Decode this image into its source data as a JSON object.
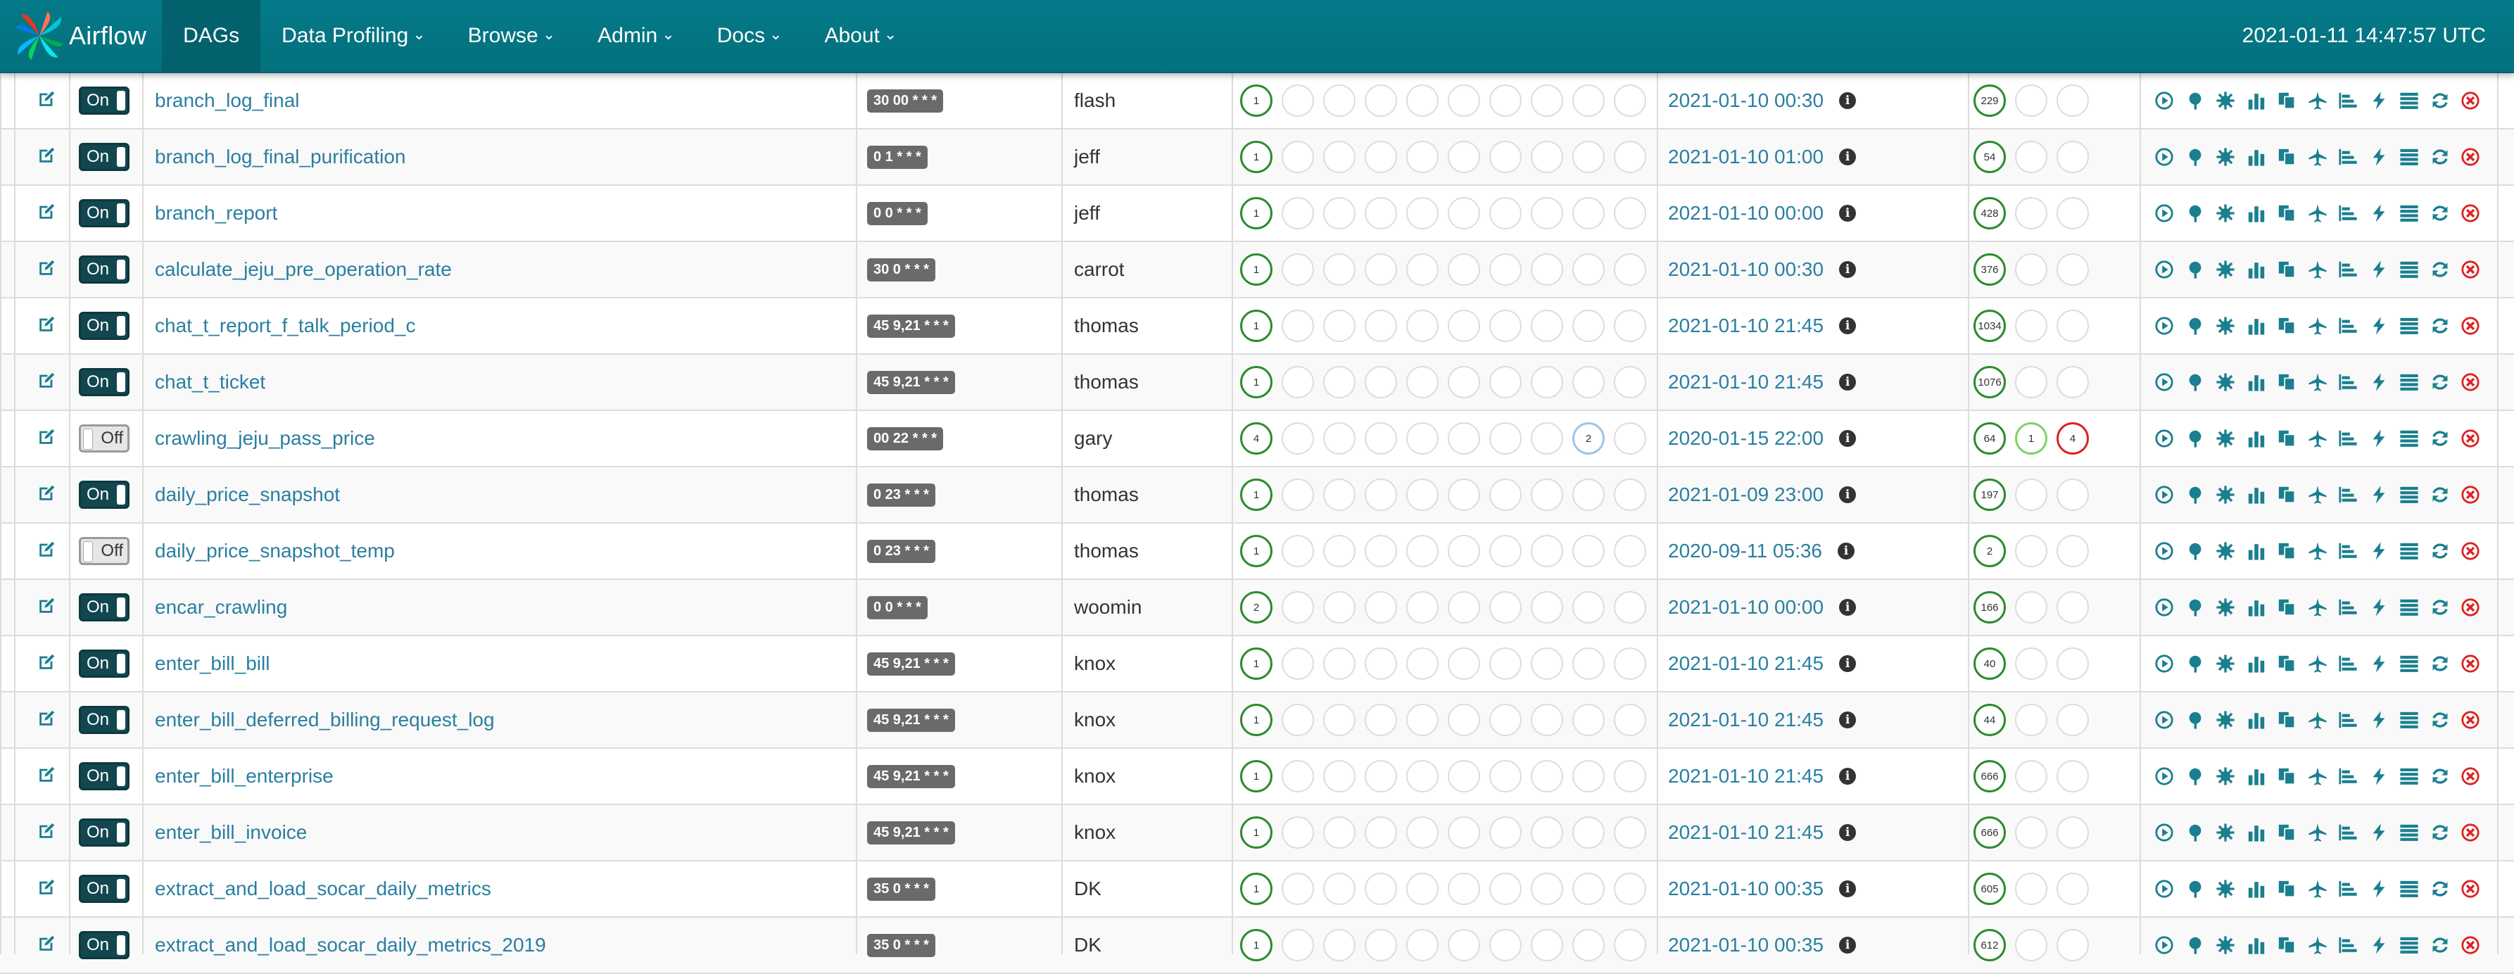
{
  "navbar": {
    "brand": "Airflow",
    "items": [
      {
        "label": "DAGs",
        "active": true,
        "dropdown": false
      },
      {
        "label": "Data Profiling",
        "active": false,
        "dropdown": true
      },
      {
        "label": "Browse",
        "active": false,
        "dropdown": true
      },
      {
        "label": "Admin",
        "active": false,
        "dropdown": true
      },
      {
        "label": "Docs",
        "active": false,
        "dropdown": true
      },
      {
        "label": "About",
        "active": false,
        "dropdown": true
      }
    ],
    "time": "2021-01-11 14:47:57 UTC"
  },
  "colors": {
    "navbar": "#017b88",
    "link": "#2a7fa0",
    "success": "#2c8c2c",
    "running": "#7fd16a",
    "failed": "#dd2222",
    "queued": "#9ec5e6",
    "toggle_on": "#12474f",
    "action_icon": "#1a7f8e"
  },
  "actions": [
    "trigger-dag-icon",
    "tree-view-icon",
    "graph-view-icon",
    "duration-chart-icon",
    "task-tries-icon",
    "landing-times-icon",
    "gantt-icon",
    "code-view-icon",
    "logs-icon",
    "refresh-icon",
    "delete-icon"
  ],
  "dags": [
    {
      "name": "branch_log_final",
      "on": true,
      "schedule": "30 00 * * *",
      "owner": "flash",
      "tasks": [
        {
          "n": "1",
          "s": "green"
        }
      ],
      "last_run": "2021-01-10 00:30",
      "runs": [
        {
          "n": "229",
          "s": "green"
        },
        {
          "n": "",
          "s": ""
        },
        {
          "n": "",
          "s": ""
        }
      ]
    },
    {
      "name": "branch_log_final_purification",
      "on": true,
      "schedule": "0 1 * * *",
      "owner": "jeff",
      "tasks": [
        {
          "n": "1",
          "s": "green"
        }
      ],
      "last_run": "2021-01-10 01:00",
      "runs": [
        {
          "n": "54",
          "s": "green"
        },
        {
          "n": "",
          "s": ""
        },
        {
          "n": "",
          "s": ""
        }
      ]
    },
    {
      "name": "branch_report",
      "on": true,
      "schedule": "0 0 * * *",
      "owner": "jeff",
      "tasks": [
        {
          "n": "1",
          "s": "green"
        }
      ],
      "last_run": "2021-01-10 00:00",
      "runs": [
        {
          "n": "428",
          "s": "green"
        },
        {
          "n": "",
          "s": ""
        },
        {
          "n": "",
          "s": ""
        }
      ]
    },
    {
      "name": "calculate_jeju_pre_operation_rate",
      "on": true,
      "schedule": "30 0 * * *",
      "owner": "carrot",
      "tasks": [
        {
          "n": "1",
          "s": "green"
        }
      ],
      "last_run": "2021-01-10 00:30",
      "runs": [
        {
          "n": "376",
          "s": "green"
        },
        {
          "n": "",
          "s": ""
        },
        {
          "n": "",
          "s": ""
        }
      ]
    },
    {
      "name": "chat_t_report_f_talk_period_c",
      "on": true,
      "schedule": "45 9,21 * * *",
      "owner": "thomas",
      "tasks": [
        {
          "n": "1",
          "s": "green"
        }
      ],
      "last_run": "2021-01-10 21:45",
      "runs": [
        {
          "n": "1034",
          "s": "green"
        },
        {
          "n": "",
          "s": ""
        },
        {
          "n": "",
          "s": ""
        }
      ]
    },
    {
      "name": "chat_t_ticket",
      "on": true,
      "schedule": "45 9,21 * * *",
      "owner": "thomas",
      "tasks": [
        {
          "n": "1",
          "s": "green"
        }
      ],
      "last_run": "2021-01-10 21:45",
      "runs": [
        {
          "n": "1076",
          "s": "green"
        },
        {
          "n": "",
          "s": ""
        },
        {
          "n": "",
          "s": ""
        }
      ]
    },
    {
      "name": "crawling_jeju_pass_price",
      "on": false,
      "schedule": "00 22 * * *",
      "owner": "gary",
      "tasks": [
        {
          "n": "4",
          "s": "green"
        },
        {
          "n": "",
          "s": ""
        },
        {
          "n": "",
          "s": ""
        },
        {
          "n": "",
          "s": ""
        },
        {
          "n": "",
          "s": ""
        },
        {
          "n": "",
          "s": ""
        },
        {
          "n": "",
          "s": ""
        },
        {
          "n": "",
          "s": ""
        },
        {
          "n": "2",
          "s": "blue"
        },
        {
          "n": "",
          "s": ""
        }
      ],
      "last_run": "2020-01-15 22:00",
      "runs": [
        {
          "n": "64",
          "s": "green"
        },
        {
          "n": "1",
          "s": "lgreen"
        },
        {
          "n": "4",
          "s": "red"
        }
      ]
    },
    {
      "name": "daily_price_snapshot",
      "on": true,
      "schedule": "0 23 * * *",
      "owner": "thomas",
      "tasks": [
        {
          "n": "1",
          "s": "green"
        }
      ],
      "last_run": "2021-01-09 23:00",
      "runs": [
        {
          "n": "197",
          "s": "green"
        },
        {
          "n": "",
          "s": ""
        },
        {
          "n": "",
          "s": ""
        }
      ]
    },
    {
      "name": "daily_price_snapshot_temp",
      "on": false,
      "schedule": "0 23 * * *",
      "owner": "thomas",
      "tasks": [
        {
          "n": "1",
          "s": "green"
        }
      ],
      "last_run": "2020-09-11 05:36",
      "runs": [
        {
          "n": "2",
          "s": "green"
        },
        {
          "n": "",
          "s": ""
        },
        {
          "n": "",
          "s": ""
        }
      ]
    },
    {
      "name": "encar_crawling",
      "on": true,
      "schedule": "0 0 * * *",
      "owner": "woomin",
      "tasks": [
        {
          "n": "2",
          "s": "green"
        }
      ],
      "last_run": "2021-01-10 00:00",
      "runs": [
        {
          "n": "166",
          "s": "green"
        },
        {
          "n": "",
          "s": ""
        },
        {
          "n": "",
          "s": ""
        }
      ]
    },
    {
      "name": "enter_bill_bill",
      "on": true,
      "schedule": "45 9,21 * * *",
      "owner": "knox",
      "tasks": [
        {
          "n": "1",
          "s": "green"
        }
      ],
      "last_run": "2021-01-10 21:45",
      "runs": [
        {
          "n": "40",
          "s": "green"
        },
        {
          "n": "",
          "s": ""
        },
        {
          "n": "",
          "s": ""
        }
      ]
    },
    {
      "name": "enter_bill_deferred_billing_request_log",
      "on": true,
      "schedule": "45 9,21 * * *",
      "owner": "knox",
      "tasks": [
        {
          "n": "1",
          "s": "green"
        }
      ],
      "last_run": "2021-01-10 21:45",
      "runs": [
        {
          "n": "44",
          "s": "green"
        },
        {
          "n": "",
          "s": ""
        },
        {
          "n": "",
          "s": ""
        }
      ]
    },
    {
      "name": "enter_bill_enterprise",
      "on": true,
      "schedule": "45 9,21 * * *",
      "owner": "knox",
      "tasks": [
        {
          "n": "1",
          "s": "green"
        }
      ],
      "last_run": "2021-01-10 21:45",
      "runs": [
        {
          "n": "666",
          "s": "green"
        },
        {
          "n": "",
          "s": ""
        },
        {
          "n": "",
          "s": ""
        }
      ]
    },
    {
      "name": "enter_bill_invoice",
      "on": true,
      "schedule": "45 9,21 * * *",
      "owner": "knox",
      "tasks": [
        {
          "n": "1",
          "s": "green"
        }
      ],
      "last_run": "2021-01-10 21:45",
      "runs": [
        {
          "n": "666",
          "s": "green"
        },
        {
          "n": "",
          "s": ""
        },
        {
          "n": "",
          "s": ""
        }
      ]
    },
    {
      "name": "extract_and_load_socar_daily_metrics",
      "on": true,
      "schedule": "35 0 * * *",
      "owner": "DK",
      "tasks": [
        {
          "n": "1",
          "s": "green"
        }
      ],
      "last_run": "2021-01-10 00:35",
      "runs": [
        {
          "n": "605",
          "s": "green"
        },
        {
          "n": "",
          "s": ""
        },
        {
          "n": "",
          "s": ""
        }
      ]
    },
    {
      "name": "extract_and_load_socar_daily_metrics_2019",
      "on": true,
      "schedule": "35 0 * * *",
      "owner": "DK",
      "tasks": [
        {
          "n": "1",
          "s": "green"
        }
      ],
      "last_run": "2021-01-10 00:35",
      "runs": [
        {
          "n": "612",
          "s": "green"
        },
        {
          "n": "",
          "s": ""
        },
        {
          "n": "",
          "s": ""
        }
      ]
    }
  ],
  "toggle": {
    "on_label": "On",
    "off_label": "Off"
  }
}
